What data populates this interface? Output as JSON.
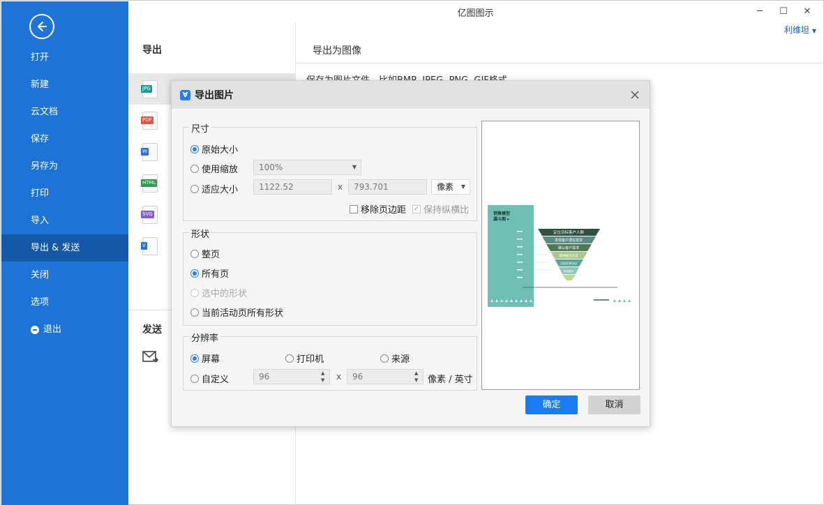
{
  "app": {
    "title": "亿图图示",
    "user": "利维坦"
  },
  "sidebar": {
    "items": [
      {
        "label": "打开"
      },
      {
        "label": "新建"
      },
      {
        "label": "云文档"
      },
      {
        "label": "保存"
      },
      {
        "label": "另存为"
      },
      {
        "label": "打印"
      },
      {
        "label": "导入"
      },
      {
        "label": "导出 & 发送",
        "active": true
      },
      {
        "label": "关闭"
      },
      {
        "label": "选项"
      },
      {
        "label": "退出"
      }
    ]
  },
  "middle": {
    "header": "导出",
    "file_types": [
      {
        "tag": "JPG",
        "color": "#1e9c8f"
      },
      {
        "tag": "PDF",
        "color": "#e05345"
      },
      {
        "tag": "W",
        "color": "#2d6fd6"
      },
      {
        "tag": "HTML",
        "color": "#2f9a4f"
      },
      {
        "tag": "SVG",
        "color": "#8660c8"
      },
      {
        "tag": "V",
        "color": "#2d6fd6"
      }
    ],
    "send_header": "发送"
  },
  "right": {
    "header": "导出为图像",
    "description": "保存为图片文件，比如BMP, JPEG, PNG, GIF格式"
  },
  "dialog": {
    "title": "导出图片",
    "size_group": {
      "label": "尺寸",
      "original": "原始大小",
      "zoom": "使用缩放",
      "zoom_value": "100%",
      "fit": "适应大小",
      "width": "1122.52",
      "height": "793.701",
      "x": "x",
      "unit": "像素",
      "remove_margin": "移除页边距",
      "keep_ratio": "保持纵横比"
    },
    "shape_group": {
      "label": "形状",
      "whole_page": "整页",
      "all_pages": "所有页",
      "selected_shapes": "选中的形状",
      "active_page_shapes": "当前活动页所有形状"
    },
    "resolution_group": {
      "label": "分辨率",
      "screen": "屏幕",
      "printer": "打印机",
      "source": "来源",
      "custom": "自定义",
      "dpi_x": "96",
      "dpi_y": "96",
      "x": "x",
      "unit": "像素 / 英寸"
    },
    "ok": "确定",
    "cancel": "取消"
  },
  "preview_thumb": {
    "title_line1": "销售模型",
    "title_line2": "漏斗图 ▸",
    "levels": [
      {
        "label": "定位目标客户人群",
        "color": "#2f4f3f"
      },
      {
        "label": "发现客户潜在需求",
        "color": "#5a8c85"
      },
      {
        "label": "确认客户需求",
        "color": "#4d7a52"
      },
      {
        "label": "提供解决方案",
        "color": "#a6c98b"
      },
      {
        "label": "达成交易协议",
        "color": "#5aa39a"
      },
      {
        "label": "售后服务",
        "color": "#8fc6b8"
      }
    ],
    "panel_color": "#6ec0b5"
  }
}
